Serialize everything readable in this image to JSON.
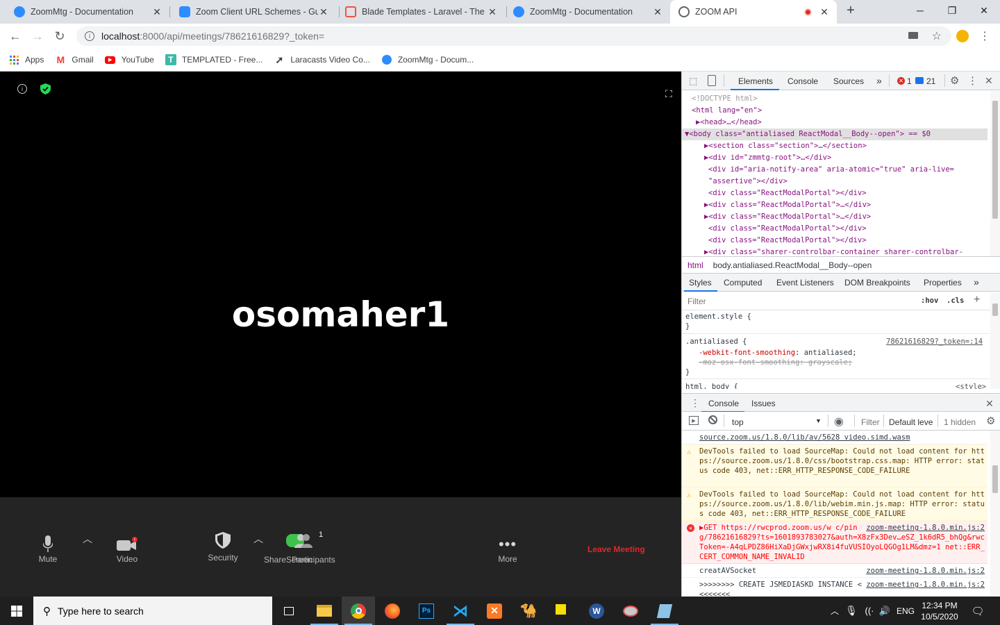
{
  "tabs": [
    {
      "title": "ZoomMtg - Documentation",
      "icon": "zoom-icon",
      "color": "#2d8cff"
    },
    {
      "title": "Zoom Client URL Schemes - Guid",
      "icon": "zoom-icon",
      "color": "#2d8cff"
    },
    {
      "title": "Blade Templates - Laravel - The P",
      "icon": "laravel-icon",
      "color": "#f05340"
    },
    {
      "title": "ZoomMtg - Documentation",
      "icon": "zoom-icon",
      "color": "#2d8cff"
    },
    {
      "title": "ZOOM API",
      "icon": "globe-icon",
      "color": "#5f6368"
    }
  ],
  "new_tab": "+",
  "address": {
    "host": "localhost",
    "path": ":8000/api/meetings/78621616829?_token="
  },
  "bookmarks": [
    {
      "label": "Apps",
      "icon": "apps-grid-icon"
    },
    {
      "label": "Gmail",
      "icon": "gmail-icon"
    },
    {
      "label": "YouTube",
      "icon": "youtube-icon"
    },
    {
      "label": "TEMPLATED - Free...",
      "icon": "templated-icon"
    },
    {
      "label": "Laracasts Video Co...",
      "icon": "laracasts-icon"
    },
    {
      "label": "ZoomMtg - Docum...",
      "icon": "zoom-icon"
    }
  ],
  "zoom": {
    "username": "osomaher1",
    "controls": {
      "mute": "Mute",
      "video": "Video",
      "security": "Security",
      "participants_overlap": "ShareScreen",
      "participants": "Participants",
      "participants_count": "1",
      "more": "More",
      "leave": "Leave Meeting"
    }
  },
  "devtools": {
    "tabs": {
      "elements": "Elements",
      "console": "Console",
      "sources": "Sources",
      "more": "»"
    },
    "errors": "1",
    "messages": "21",
    "dom": [
      {
        "t": "<!DOCTYPE html>",
        "k": "cmt"
      },
      {
        "t": "<html lang=\"en\">"
      },
      {
        "t": "▶<head>…</head>"
      },
      {
        "t": "▼<body class=\"antialiased ReactModal__Body--open\"> == $0"
      },
      {
        "t": "▶<section class=\"section\">…</section>"
      },
      {
        "t": "▶<div id=\"zmmtg-root\">…</div>"
      },
      {
        "t": "<div id=\"aria-notify-area\" aria-atomic=\"true\" aria-live="
      },
      {
        "t": "\"assertive\"></div>"
      },
      {
        "t": "<div class=\"ReactModalPortal\"></div>"
      },
      {
        "t": "▶<div class=\"ReactModalPortal\">…</div>"
      },
      {
        "t": "▶<div class=\"ReactModalPortal\">…</div>"
      },
      {
        "t": "<div class=\"ReactModalPortal\"></div>"
      },
      {
        "t": "<div class=\"ReactModalPortal\"></div>"
      },
      {
        "t": "▶<div class=\"sharer-controlbar-container sharer-controlbar-"
      }
    ],
    "breadcrumbs": [
      "html",
      "body.antialiased.ReactModal__Body--open"
    ],
    "style_tabs": [
      "Styles",
      "Computed",
      "Event Listeners",
      "DOM Breakpoints",
      "Properties",
      "»"
    ],
    "filter_placeholder": "Filter",
    "hov": ":hov",
    "cls": ".cls",
    "styles": {
      "element_style": "element.style {",
      "close": "}",
      "rule_selector": ".antialiased {",
      "rule_source": "78621616829?_token=:14",
      "prop1_name": "-webkit-font-smoothing",
      "prop1_value": "antialiased;",
      "prop2": "-moz-osx-font-smoothing: grayscale;",
      "rule2_selector": "html, body {",
      "rule2_source": "<style>"
    },
    "drawer_tabs": [
      "Console",
      "Issues"
    ],
    "console_context": "top",
    "console_filter": "Filter",
    "default_levels": "Default leve",
    "hidden": "1 hidden",
    "console_lines": [
      {
        "type": "log",
        "text": "source.zoom.us/1.8.0/lib/av/5628 video.simd.wasm",
        "source": ""
      },
      {
        "type": "warn",
        "text": "DevTools failed to load SourceMap: Could not load content for https://source.zoom.us/1.8.0/css/bootstrap.css.map: HTTP error: status code 403, net::ERR_HTTP_RESPONSE_CODE_FAILURE",
        "source": ""
      },
      {
        "type": "warn",
        "text": "DevTools failed to load SourceMap: Could not load content for https://source.zoom.us/1.8.0/lib/webim.min.js.map: HTTP error: status code 403, net::ERR_HTTP_RESPONSE_CODE_FAILURE",
        "source": ""
      },
      {
        "type": "err",
        "text": "▶GET https://rwcprod.zoom.us/w c/ping/78621616829?ts=1601893783027&auth=X8zFx3Dev…eSZ_1k6dR5_bhQg&rwcToken=-A4qLPDZ86HiXaDjGWxjwRX8i4fuVUSIOyoLQGOg1LM&dmz=1 net::ERR_CERT_COMMON_NAME_INVALID",
        "source": "zoom-meeting-1.8.0.min.js:2"
      },
      {
        "type": "log",
        "text": "creatAVSocket",
        "source": "zoom-meeting-1.8.0.min.js:2"
      },
      {
        "type": "log",
        "text": ">>>>>>>> CREATE JSMEDIASKD INSTANCE <<<<<<<<",
        "source": "zoom-meeting-1.8.0.min.js:2"
      }
    ]
  },
  "taskbar": {
    "search_placeholder": "Type here to search",
    "lang": "ENG",
    "time": "12:34 PM",
    "date": "10/5/2020"
  }
}
